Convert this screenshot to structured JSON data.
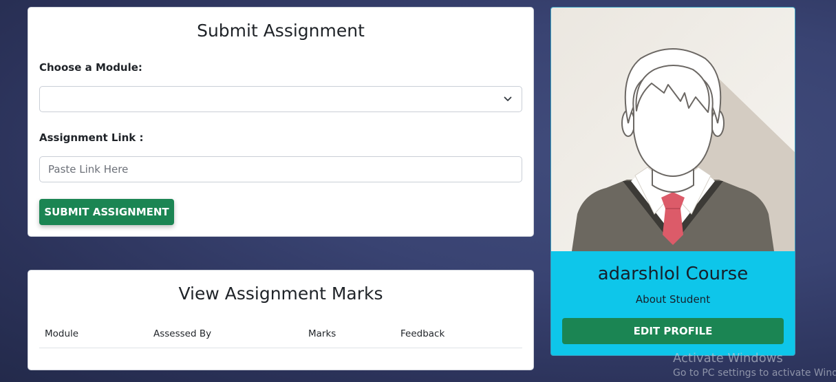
{
  "submit_section": {
    "title": "Submit Assignment",
    "module_label": "Choose a Module:",
    "module_value": "",
    "link_label": "Assignment Link :",
    "link_placeholder": "Paste Link Here",
    "link_value": "",
    "submit_button": "SUBMIT ASSIGNMENT"
  },
  "marks_section": {
    "title": "View Assignment Marks",
    "columns": [
      "Module",
      "Assessed By",
      "Marks",
      "Feedback"
    ],
    "rows": []
  },
  "profile": {
    "name": "adarshlol Course",
    "subtitle": "About Student",
    "edit_button": "EDIT PROFILE",
    "avatar_icon": "student-avatar-icon"
  },
  "watermark": {
    "title": "Activate Windows",
    "subtitle": "Go to PC settings to activate Windows."
  },
  "colors": {
    "primary_button": "#1b8553",
    "profile_accent": "#0ec6ea",
    "page_background": "#394372"
  }
}
